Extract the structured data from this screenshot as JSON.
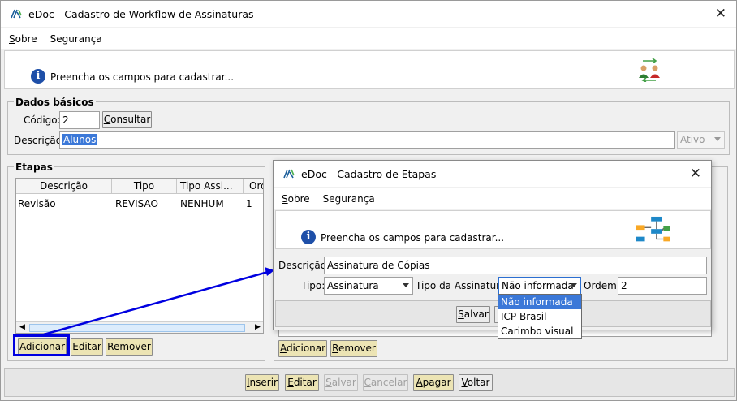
{
  "main_window": {
    "title": "eDoc - Cadastro de Workflow de Assinaturas",
    "menu": [
      "Sobre",
      "Segurança"
    ],
    "info_text": "Preencha os campos para cadastrar...",
    "dados_basicos": {
      "title": "Dados básicos",
      "codigo_label": "Código:",
      "codigo_value": "2",
      "consultar_label": "Consultar",
      "descricao_label": "Descrição:",
      "descricao_value": "Alunos",
      "status_value": "Ativo"
    },
    "etapas": {
      "title": "Etapas",
      "columns": [
        "Descrição",
        "Tipo",
        "Tipo Assi...",
        "Ord"
      ],
      "rows": [
        {
          "descricao": "Revisão",
          "tipo": "REVISAO",
          "tipo_assinatura": "NENHUM",
          "ordem": "1"
        }
      ],
      "buttons": {
        "adicionar": "Adicionar",
        "editar": "Editar",
        "remover": "Remover"
      }
    },
    "footer_buttons": {
      "inserir": "Inserir",
      "editar": "Editar",
      "salvar": "Salvar",
      "cancelar": "Cancelar",
      "apagar": "Apagar",
      "voltar": "Voltar"
    },
    "right_panel_buttons": {
      "adicionar": "Adicionar",
      "remover": "Remover"
    }
  },
  "dialog": {
    "title": "eDoc - Cadastro de Etapas",
    "menu": [
      "Sobre",
      "Segurança"
    ],
    "info_text": "Preencha os campos para cadastrar...",
    "descricao_label": "Descrição:",
    "descricao_value": "Assinatura de Cópias",
    "tipo_label": "Tipo:",
    "tipo_value": "Assinatura",
    "tipo_assinatura_label": "Tipo da Assinatura:",
    "tipo_assinatura_value": "Não informada",
    "ordem_label": "Ordem:",
    "ordem_value": "2",
    "salvar_label": "Salvar",
    "dropdown_options": [
      "Não informada",
      "ICP Brasil",
      "Carimbo visual"
    ],
    "dropdown_selected": "Não informada"
  },
  "colors": {
    "highlight": "#0000ff",
    "button_face": "#ece4b4",
    "selection": "#3b78d8"
  }
}
